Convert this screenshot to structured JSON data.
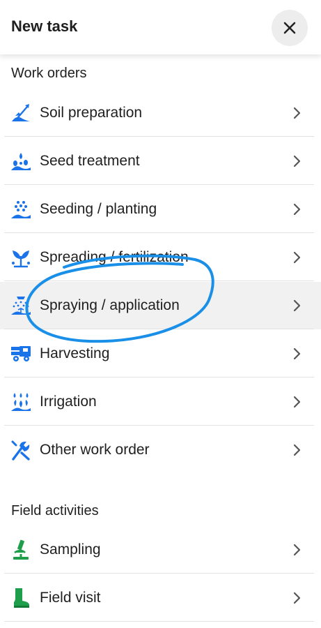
{
  "header": {
    "title": "New task",
    "close_icon": "close-icon"
  },
  "colors": {
    "icon_blue": "#1a73e8",
    "icon_green": "#1e9e4a",
    "annotation": "#1a8fe8"
  },
  "sections": {
    "work_orders": {
      "heading": "Work orders",
      "items": [
        {
          "label": "Soil preparation",
          "icon": "shovel-icon"
        },
        {
          "label": "Seed treatment",
          "icon": "seed-treatment-icon"
        },
        {
          "label": "Seeding / planting",
          "icon": "seeding-icon"
        },
        {
          "label": "Spreading / fertilization",
          "icon": "fertilization-icon"
        },
        {
          "label": "Spraying / application",
          "icon": "sprayer-icon"
        },
        {
          "label": "Harvesting",
          "icon": "harvester-icon"
        },
        {
          "label": "Irrigation",
          "icon": "irrigation-icon"
        },
        {
          "label": "Other work order",
          "icon": "tools-icon"
        }
      ]
    },
    "field_activities": {
      "heading": "Field activities",
      "items": [
        {
          "label": "Sampling",
          "icon": "microscope-icon"
        },
        {
          "label": "Field visit",
          "icon": "boot-icon"
        }
      ]
    }
  }
}
